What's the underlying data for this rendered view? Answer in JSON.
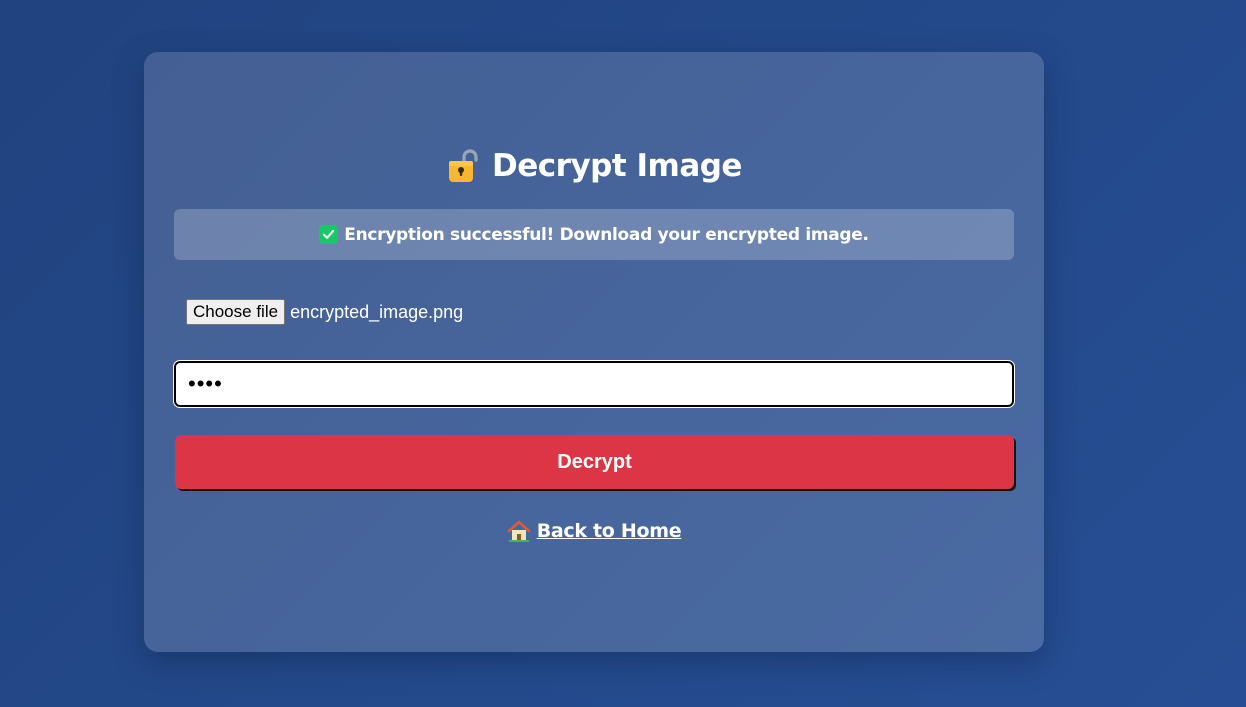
{
  "page": {
    "title": "Decrypt Image",
    "title_icon": "unlocked-padlock-icon"
  },
  "alert": {
    "icon": "check-mark-icon",
    "message": "Encryption successful! Download your encrypted image.",
    "accent_color": "#17c964"
  },
  "file_input": {
    "button_label": "Choose file",
    "selected_file": "encrypted_image.png"
  },
  "password_input": {
    "value": "••••",
    "type": "password"
  },
  "decrypt_button": {
    "label": "Decrypt",
    "color": "#dc3545"
  },
  "home_link": {
    "icon": "house-icon",
    "label": "Back to Home"
  }
}
